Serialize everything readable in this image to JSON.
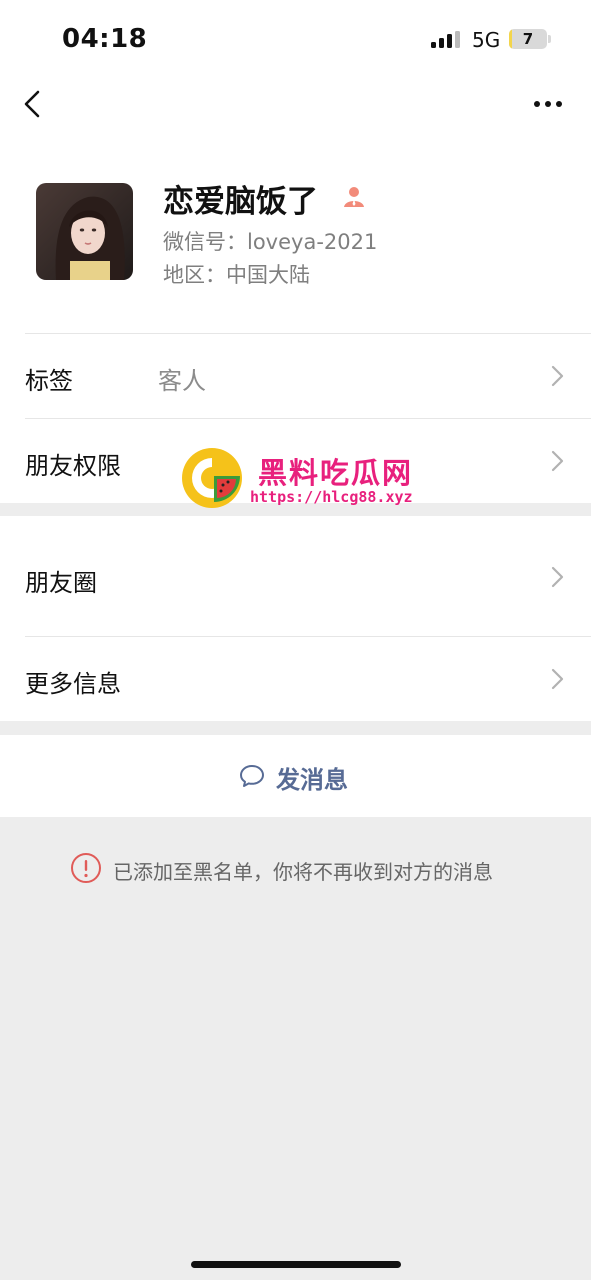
{
  "status_bar": {
    "time": "04:18",
    "network": "5G",
    "battery": "7",
    "battery_level": 0.07
  },
  "nav": {
    "back_icon": "chevron-left-icon",
    "more_icon": "ellipsis-icon"
  },
  "profile": {
    "nickname": "恋爱脑饭了",
    "wechat_id": "微信号：loveya-2021",
    "region": "地区：中国大陆",
    "badge_icon": "person-icon"
  },
  "rows": {
    "tags": {
      "label": "标签",
      "value": "客人"
    },
    "permissions": {
      "label": "朋友权限"
    },
    "moments": {
      "label": "朋友圈"
    },
    "more_info": {
      "label": "更多信息"
    }
  },
  "send_message": {
    "label": "发消息",
    "icon": "chat-bubble-icon"
  },
  "notice": {
    "text": "已添加至黑名单，你将不再收到对方的消息",
    "icon": "alert-circle-icon"
  },
  "watermark": {
    "title": "黑料吃瓜网",
    "url": "https://hlcg88.xyz"
  },
  "colors": {
    "link": "#576b95",
    "alert": "#e05b58",
    "watermark": "#e8207d",
    "background": "#ededed"
  }
}
